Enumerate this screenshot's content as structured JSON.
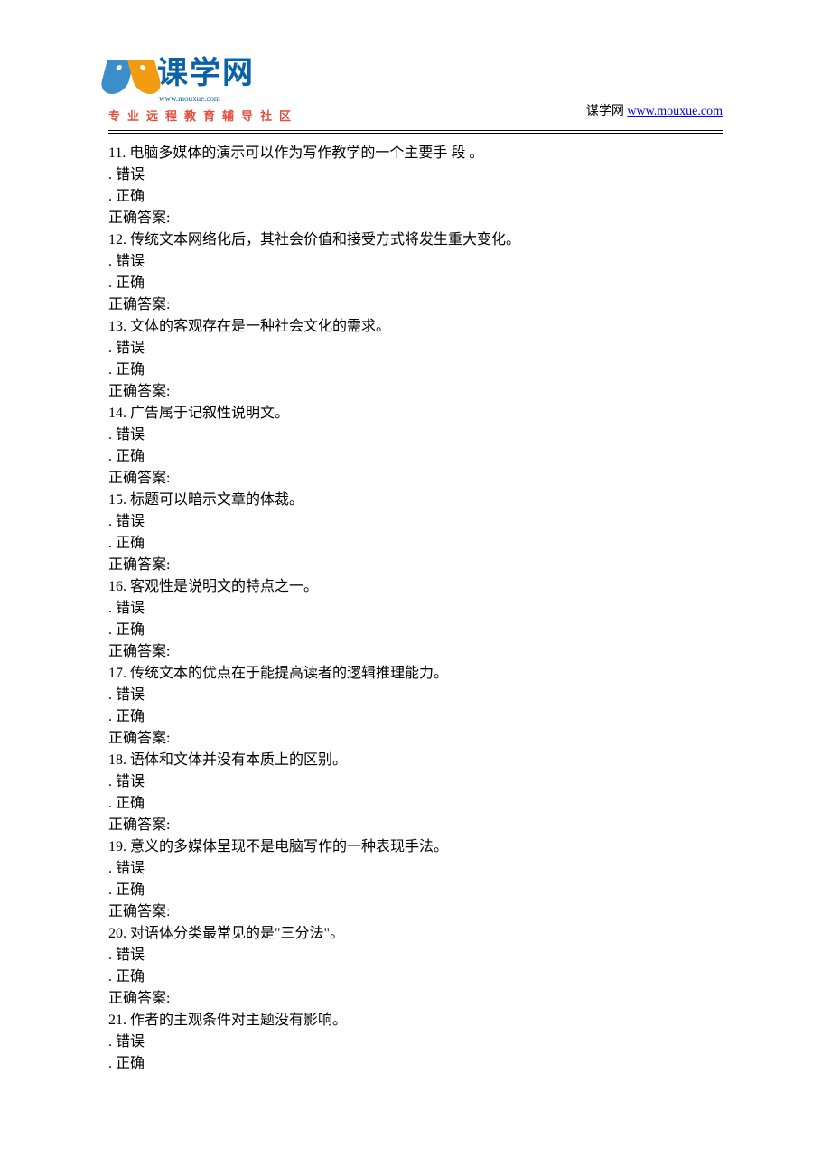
{
  "header": {
    "logo_main": "课学网",
    "logo_sub": "www.mouxue.com",
    "tagline": "专业远程教育辅导社区",
    "site_label": "谋学网",
    "site_url": "www.mouxue.com"
  },
  "option_false": ". 错误",
  "option_true": ". 正确",
  "answer_label": "正确答案:",
  "questions": [
    {
      "num": "11.",
      "text": "电脑多媒体的演示可以作为写作教学的一个主要手 段 。"
    },
    {
      "num": "12.",
      "text": "传统文本网络化后，其社会价值和接受方式将发生重大变化。"
    },
    {
      "num": "13.",
      "text": "文体的客观存在是一种社会文化的需求。"
    },
    {
      "num": "14.",
      "text": "广告属于记叙性说明文。"
    },
    {
      "num": "15.",
      "text": "标题可以暗示文章的体裁。"
    },
    {
      "num": "16.",
      "text": "客观性是说明文的特点之一。"
    },
    {
      "num": "17.",
      "text": "传统文本的优点在于能提高读者的逻辑推理能力。"
    },
    {
      "num": "18.",
      "text": "语体和文体并没有本质上的区别。"
    },
    {
      "num": "19.",
      "text": "意义的多媒体呈现不是电脑写作的一种表现手法。"
    },
    {
      "num": "20.",
      "text": "对语体分类最常见的是\"三分法\"。"
    },
    {
      "num": "21.",
      "text": "作者的主观条件对主题没有影响。"
    }
  ]
}
